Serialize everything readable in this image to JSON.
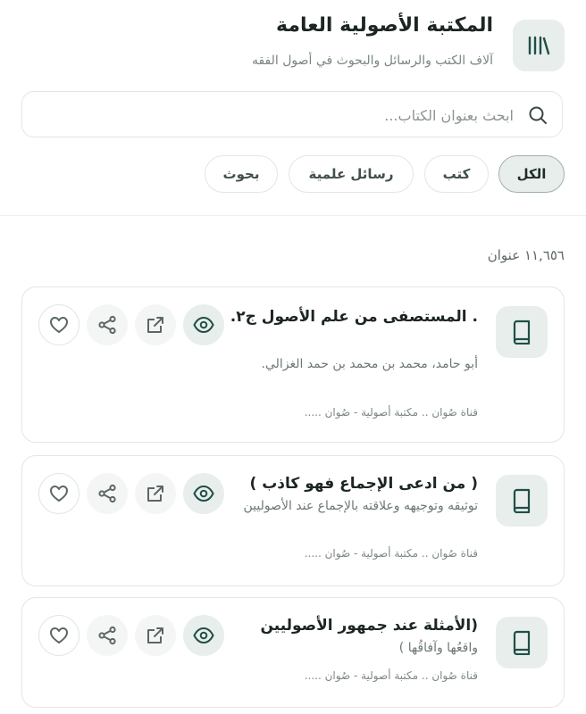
{
  "header": {
    "title": "المكتبة الأصولية العامة",
    "subtitle": "آلاف الكتب والرسائل والبحوث في أصول الفقه",
    "logo_icon": "library-icon"
  },
  "search": {
    "placeholder": "ابحث بعنوان الكتاب...",
    "value": ""
  },
  "filters": [
    {
      "label": "الكل",
      "active": true
    },
    {
      "label": "كتب",
      "active": false
    },
    {
      "label": "رسائل علمية",
      "active": false
    },
    {
      "label": "بحوث",
      "active": false
    }
  ],
  "count_text": "١١,٦٥٦ عنوان",
  "books": [
    {
      "title": ". المستصفى من علم الأصول ج٢.",
      "author": "أبو حامد، محمد بن محمد بن حمد الغزالي.",
      "meta": "قناة صُوان .. مكتبة أصولية - صُوان ....."
    },
    {
      "title": "( من ادعى الإجماع فهو كاذب )",
      "author": "توثيقه وتوجيهه وعلاقته بالإجماع عند الأصوليين",
      "meta": "قناة صُوان .. مكتبة أصولية - صُوان ....."
    },
    {
      "title": "(الأمثلة عند جمهور الأصوليين",
      "author": "واقعُها وآفاقُها )",
      "meta": "قناة صُوان .. مكتبة أصولية - صُوان ....."
    }
  ],
  "icons": {
    "book": "book-icon",
    "view": "eye-icon",
    "open": "external-link-icon",
    "share": "share-icon",
    "favorite": "heart-icon",
    "search": "search-icon"
  },
  "colors": {
    "accent": "#1f4f47",
    "tile_bg": "#e8eeec",
    "border": "#e2e6e4"
  }
}
